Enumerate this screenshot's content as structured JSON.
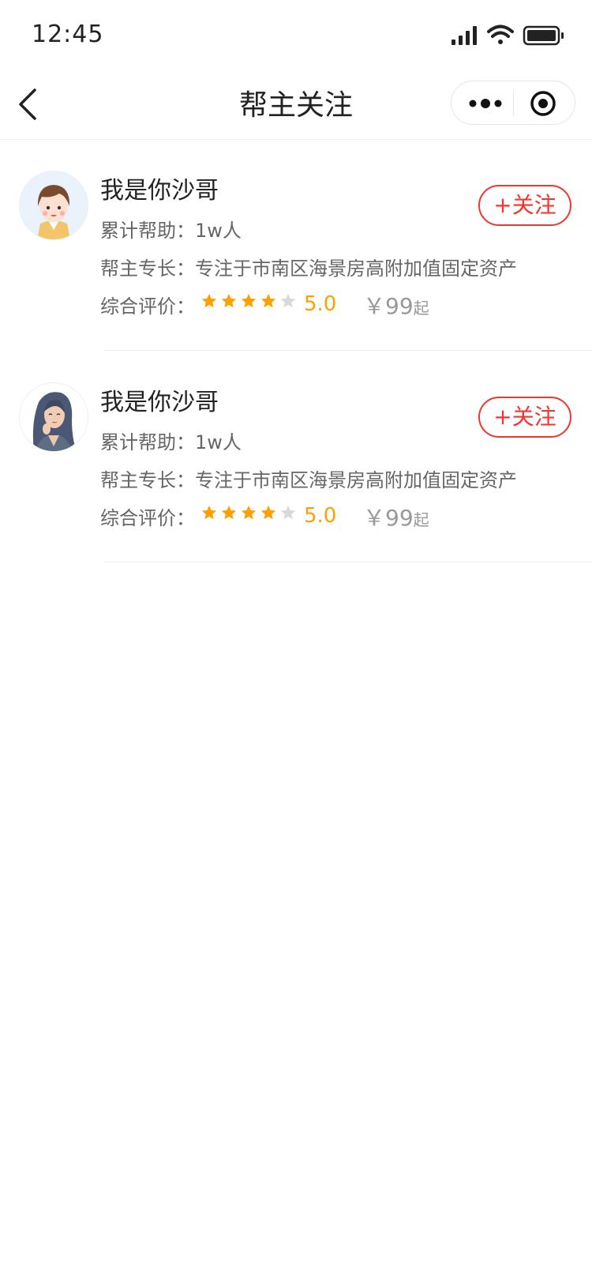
{
  "status_bar": {
    "time": "12:45"
  },
  "nav": {
    "title": "帮主关注"
  },
  "colors": {
    "accent_red": "#f0362f",
    "star_orange": "#ffa000",
    "star_gray": "#d9d9d9",
    "text_gray": "#666666"
  },
  "list": [
    {
      "name": "我是你沙哥",
      "help_label": "累计帮助：",
      "help_value": "1w人",
      "spec_label": "帮主专长：",
      "spec_value": "专注于市南区海景房高附加值固定资产",
      "rating_label": "综合评价：",
      "stars_filled": 4,
      "stars_total": 5,
      "score": "5.0",
      "price": "￥99",
      "price_unit": "起",
      "follow_label": "+关注",
      "avatar_icon": "cartoon-girl-avatar-icon"
    },
    {
      "name": "我是你沙哥",
      "help_label": "累计帮助：",
      "help_value": "1w人",
      "spec_label": "帮主专长：",
      "spec_value": "专注于市南区海景房高附加值固定资产",
      "rating_label": "综合评价：",
      "stars_filled": 4,
      "stars_total": 5,
      "score": "5.0",
      "price": "￥99",
      "price_unit": "起",
      "follow_label": "+关注",
      "avatar_icon": "woman-long-hair-avatar-icon"
    }
  ]
}
